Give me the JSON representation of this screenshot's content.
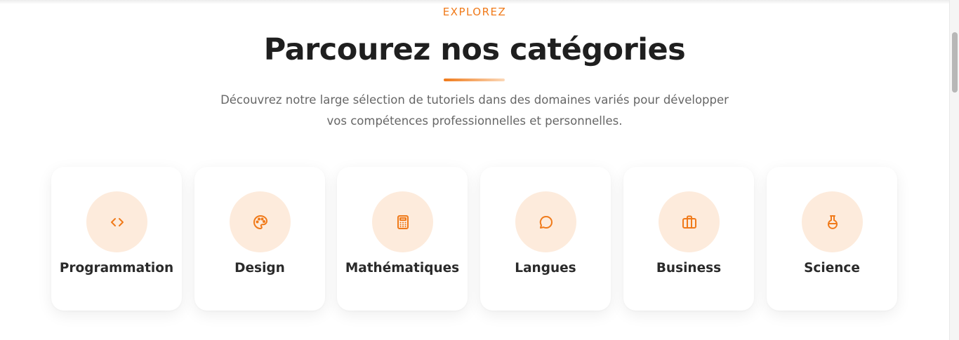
{
  "section": {
    "eyebrow": "EXPLOREZ",
    "title": "Parcourez nos catégories",
    "description_line1": "Découvrez notre large sélection de tutoriels dans des domaines variés pour développer",
    "description_line2": "vos compétences professionnelles et personnelles."
  },
  "categories": [
    {
      "label": "Programmation",
      "icon": "code-icon"
    },
    {
      "label": "Design",
      "icon": "palette-icon"
    },
    {
      "label": "Mathématiques",
      "icon": "calculator-icon"
    },
    {
      "label": "Langues",
      "icon": "speech-bubble-icon"
    },
    {
      "label": "Business",
      "icon": "briefcase-icon"
    },
    {
      "label": "Science",
      "icon": "flask-icon"
    }
  ],
  "colors": {
    "accent": "#f07a1a",
    "icon_circle": "#fdebdc",
    "title": "#1f1f1f",
    "text": "#666666"
  }
}
